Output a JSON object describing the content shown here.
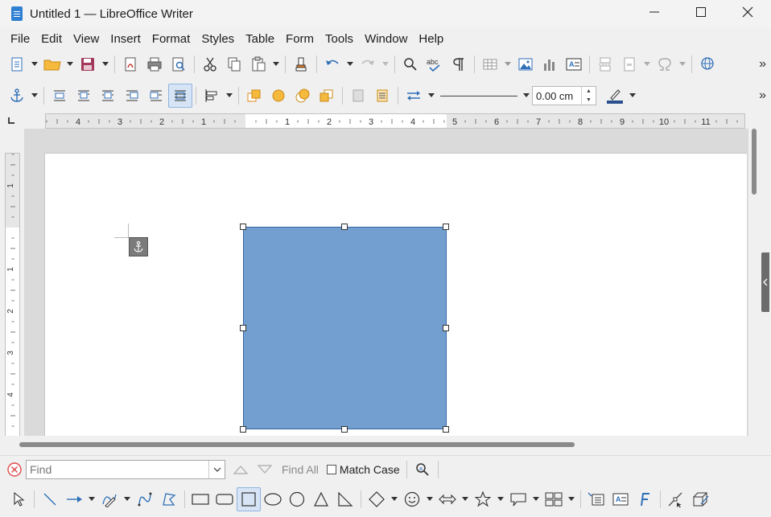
{
  "window": {
    "title": "Untitled 1 — LibreOffice Writer"
  },
  "menu": [
    "File",
    "Edit",
    "View",
    "Insert",
    "Format",
    "Styles",
    "Table",
    "Form",
    "Tools",
    "Window",
    "Help"
  ],
  "properties_toolbar": {
    "line_width_value": "0.00 cm"
  },
  "ruler": {
    "horizontal_left": [
      "4",
      "3",
      "2",
      "1"
    ],
    "horizontal_right": [
      "1",
      "2",
      "3",
      "4",
      "5",
      "6",
      "7",
      "8",
      "9",
      "10",
      "11",
      "1"
    ],
    "vertical": [
      "1",
      "1",
      "2",
      "3",
      "4"
    ]
  },
  "find_toolbar": {
    "placeholder": "Find",
    "find_all_label": "Find All",
    "match_case_label": "Match Case"
  },
  "shape": {
    "fill_color": "#729fcf",
    "border_color": "#3465a4"
  },
  "colors": {
    "accent_icon": "#2f6fb8",
    "active_button": "#d6e4f5"
  }
}
